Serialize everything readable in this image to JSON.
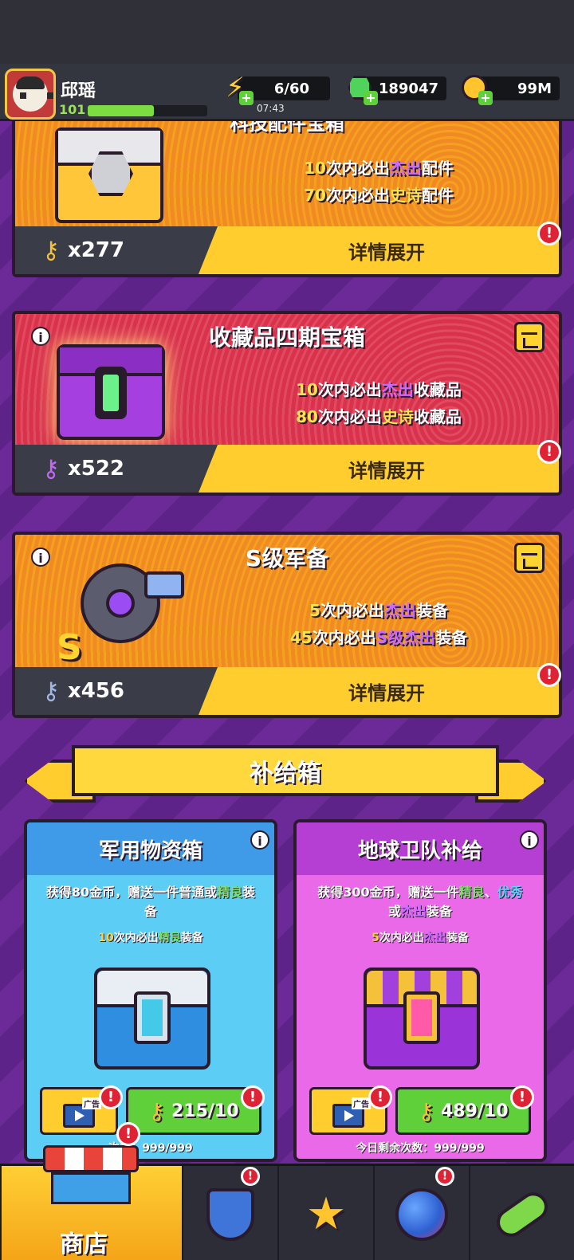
{
  "player": {
    "name": "邱瑶",
    "level": "101",
    "xp_fraction": 0.55
  },
  "resources": {
    "energy": "6/60",
    "energy_timer": "07:43",
    "gems": "189047",
    "coins": "99M"
  },
  "chests": [
    {
      "title": "科技配件宝箱",
      "line1_pre": "10",
      "line1_mid": "次内必出",
      "line1_hl": "杰出",
      "line1_post": "配件",
      "line2_pre": "70",
      "line2_mid": "次内必出",
      "line2_hl": "史诗",
      "line2_post": "配件",
      "key_count": "x277",
      "button": "详情展开",
      "theme": "#f08a22"
    },
    {
      "title": "收藏品四期宝箱",
      "line1_pre": "10",
      "line1_mid": "次内必出",
      "line1_hl": "杰出",
      "line1_post": "收藏品",
      "line2_pre": "80",
      "line2_mid": "次内必出",
      "line2_hl": "史诗",
      "line2_post": "收藏品",
      "key_count": "x522",
      "button": "详情展开",
      "theme": "#d8324d"
    },
    {
      "title": "S级军备",
      "line1_pre": "5",
      "line1_mid": "次内必出",
      "line1_hl": "杰出",
      "line1_post": "装备",
      "line2_pre": "45",
      "line2_mid": "次内必出",
      "line2_hl": "S级杰出",
      "line2_post": "装备",
      "key_count": "x456",
      "button": "详情展开",
      "theme": "#f08a22"
    }
  ],
  "alert_mark": "!",
  "info_mark": "i",
  "supply_banner": "补给箱",
  "supplies": [
    {
      "title": "军用物资箱",
      "desc_a": "获得80金币，赠送一件普通或",
      "desc_hl": "精良",
      "desc_b": "装备",
      "guar_pre": "10",
      "guar_mid": "次内必出",
      "guar_hl": "精良",
      "guar_post": "装备",
      "ad_label": "广告",
      "keys": "215/10",
      "remain": "次数：999/999"
    },
    {
      "title": "地球卫队补给",
      "desc_a": "获得300金币，赠送一件",
      "desc_hl": "精良",
      "desc_b": "、",
      "desc_hl2": "优秀",
      "desc_c": "或",
      "desc_hl3": "杰出",
      "desc_d": "装备",
      "guar_pre": "5",
      "guar_mid": "次内必出",
      "guar_hl": "杰出",
      "guar_post": "装备",
      "ad_label": "广告",
      "keys": "489/10",
      "remain": "今日剩余次数：999/999"
    }
  ],
  "nav": {
    "shop_label": "商店"
  },
  "colors": {
    "accent_yellow": "#ffcd2e",
    "green": "#5fd039",
    "alert_red": "#e02334",
    "purple_bg": "#5e2388"
  }
}
